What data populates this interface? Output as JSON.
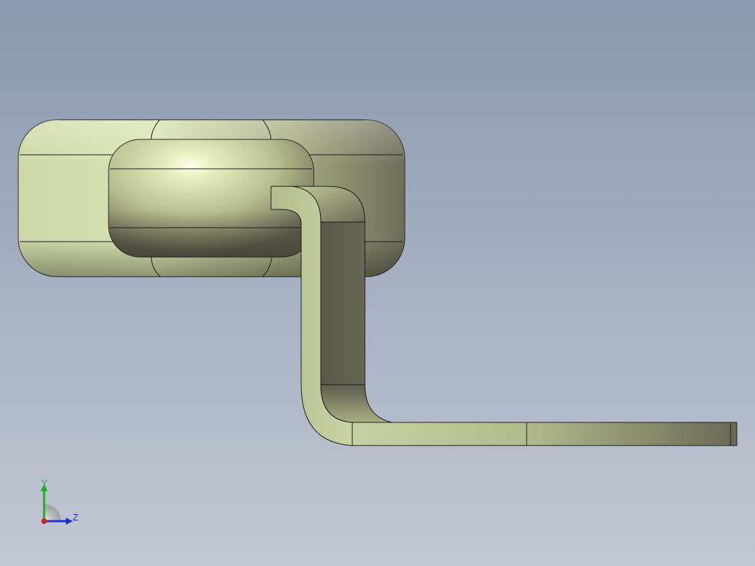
{
  "viewport": {
    "background_top": "#8a99ad",
    "background_bottom": "#c2c8d4"
  },
  "model": {
    "face_color": "#c5cf9f",
    "shadow_color": "#5e5c4c",
    "edge_color": "#1a1a1a"
  },
  "triad": {
    "y_label": "Y",
    "z_label": "Z",
    "y_color": "#1fb01f",
    "z_color": "#1f2fd0",
    "x_color": "#d01f1f"
  }
}
